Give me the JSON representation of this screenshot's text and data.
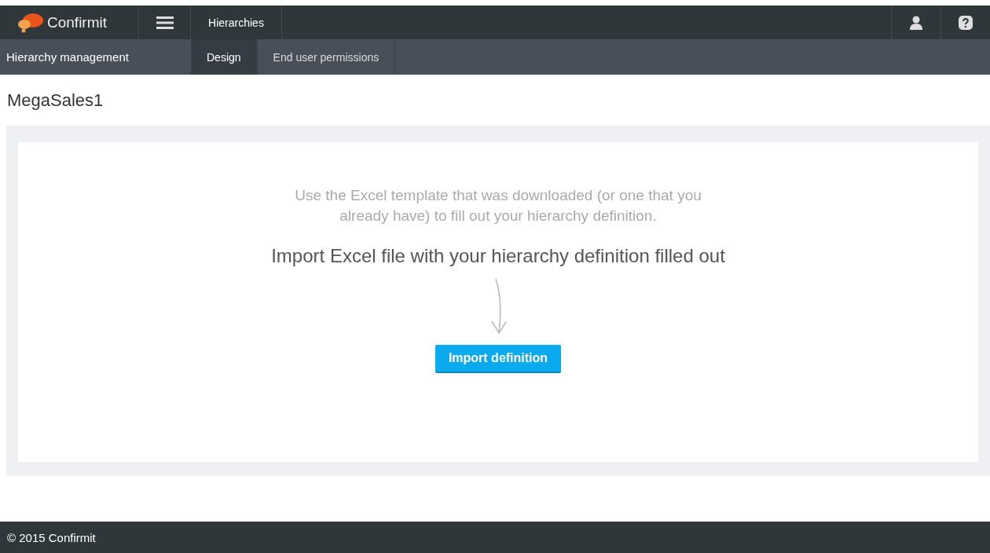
{
  "top_bar": {
    "logo": "Confirmit",
    "section": "Hierarchies"
  },
  "sub_nav": {
    "title": "Hierarchy management",
    "tabs": [
      {
        "label": "Design",
        "selected": true
      },
      {
        "label": "End user permissions",
        "selected": false
      }
    ]
  },
  "page_title": "MegaSales1",
  "instructions": "Use the Excel template that was downloaded (or one that you already have) to fill out your hierarchy definition.",
  "heading": "Import Excel file with your hierarchy definition filled out",
  "button": "Import definition",
  "footer": "© 2015 Confirmit"
}
